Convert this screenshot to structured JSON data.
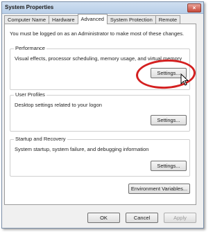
{
  "window": {
    "title": "System Properties",
    "close_glyph": "×"
  },
  "tabs": [
    {
      "label": "Computer Name",
      "active": false
    },
    {
      "label": "Hardware",
      "active": false
    },
    {
      "label": "Advanced",
      "active": true
    },
    {
      "label": "System Protection",
      "active": false
    },
    {
      "label": "Remote",
      "active": false
    }
  ],
  "advanced": {
    "notice": "You must be logged on as an Administrator to make most of these changes.",
    "performance": {
      "title": "Performance",
      "description": "Visual effects, processor scheduling, memory usage, and virtual memory",
      "button": "Settings..."
    },
    "user_profiles": {
      "title": "User Profiles",
      "description": "Desktop settings related to your logon",
      "button": "Settings..."
    },
    "startup_recovery": {
      "title": "Startup and Recovery",
      "description": "System startup, system failure, and debugging information",
      "button": "Settings..."
    },
    "environment_button": "Environment Variables..."
  },
  "footer": {
    "ok": "OK",
    "cancel": "Cancel",
    "apply": "Apply",
    "apply_disabled": true
  },
  "annotation": {
    "highlight_color": "#d42020"
  },
  "icons": {
    "close": "close-icon",
    "cursor": "mouse-pointer-icon"
  }
}
